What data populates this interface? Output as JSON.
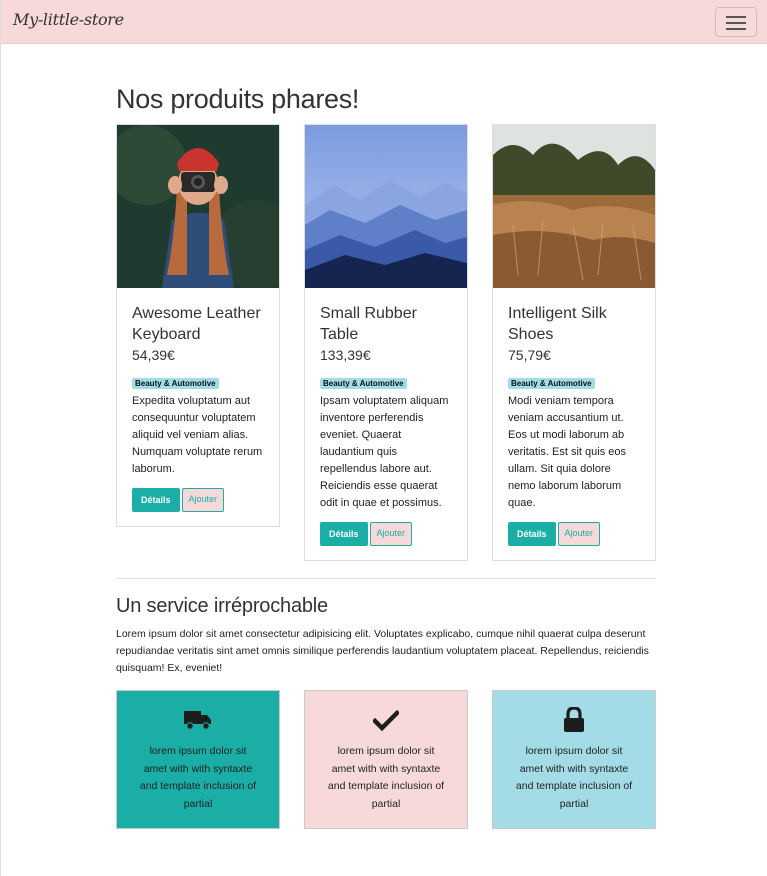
{
  "navbar": {
    "brand": "My-little-store"
  },
  "products_section": {
    "title": "Nos produits phares!"
  },
  "products": [
    {
      "name": "Awesome Leather Keyboard",
      "price": "54,39€",
      "category": "Beauty & Automotive",
      "description": "Expedita voluptatum aut consequuntur voluptatem aliquid vel veniam alias. Numquam voluptate rerum laborum.",
      "details_label": "Détails",
      "add_label": "Ajouter"
    },
    {
      "name": "Small Rubber Table",
      "price": "133,39€",
      "category": "Beauty & Automotive",
      "description": "Ipsam voluptatem aliquam inventore perferendis eveniet. Quaerat laudantium quis repellendus labore aut. Reiciendis esse quaerat odit in quae et possimus.",
      "details_label": "Détails",
      "add_label": "Ajouter"
    },
    {
      "name": "Intelligent Silk Shoes",
      "price": "75,79€",
      "category": "Beauty & Automotive",
      "description": "Modi veniam tempora veniam accusantium ut. Eos ut modi laborum ab veritatis. Est sit quis eos ullam. Sit quia dolore nemo laborum laborum quae.",
      "details_label": "Détails",
      "add_label": "Ajouter"
    }
  ],
  "service_section": {
    "title": "Un service irréprochable",
    "text": "Lorem ipsum dolor sit amet consectetur adipisicing elit. Voluptates explicabo, cumque nihil quaerat culpa deserunt repudiandae veritatis sint amet omnis similique perferendis laudantium voluptatem placeat. Repellendus, reiciendis quisquam! Ex, eveniet!"
  },
  "features": [
    {
      "icon": "truck-icon",
      "text": "lorem ipsum dolor sit amet with with syntaxte and template inclusion of partial",
      "color": "#1aaea6"
    },
    {
      "icon": "check-icon",
      "text": "lorem ipsum dolor sit amet with with syntaxte and template inclusion of partial",
      "color": "#f7d9da"
    },
    {
      "icon": "lock-icon",
      "text": "lorem ipsum dolor sit amet with with syntaxte and template inclusion of partial",
      "color": "#a3dce6"
    }
  ],
  "colors": {
    "accent": "#1aaea6",
    "pink": "#f7d9da",
    "light_blue": "#a3dce6"
  }
}
